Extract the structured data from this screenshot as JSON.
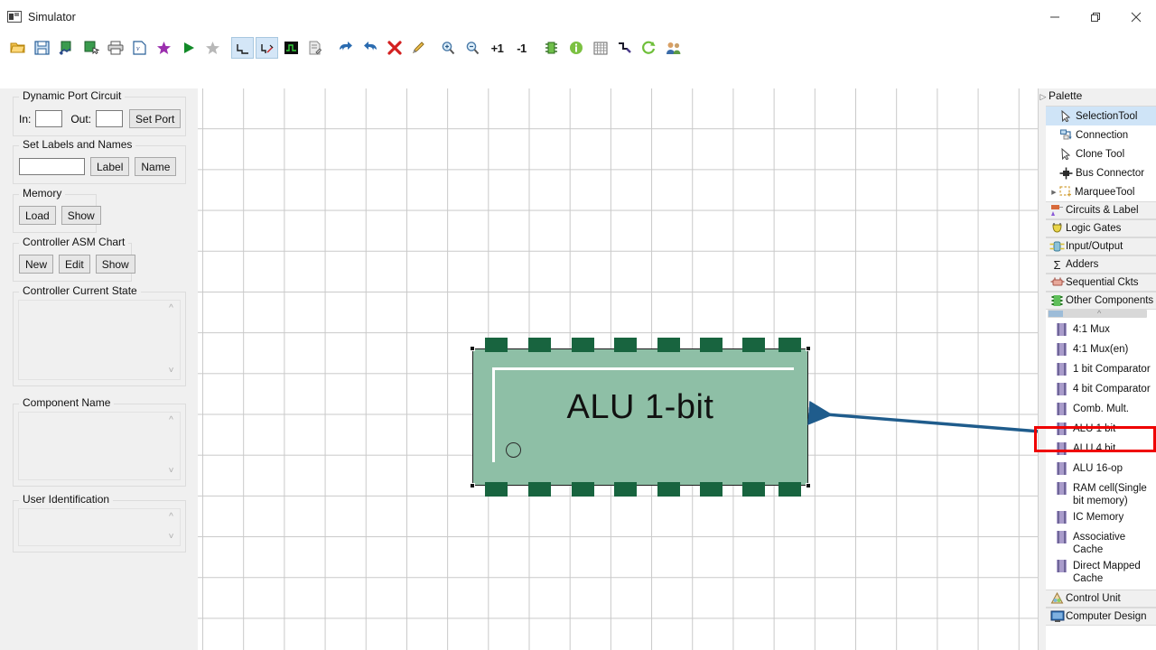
{
  "window": {
    "title": "Simulator",
    "icon": "app-icon",
    "controls": {
      "minimize": "minimize-icon",
      "restore": "restore-icon",
      "close": "close-icon"
    }
  },
  "toolbar": {
    "buttons": [
      {
        "name": "open-file",
        "icon": "folder-open-icon",
        "selected": false
      },
      {
        "name": "save-file",
        "icon": "floppy-disk-icon",
        "selected": false
      },
      {
        "name": "export-circuit",
        "icon": "export-icon",
        "selected": false
      },
      {
        "name": "import-circuit",
        "icon": "import-icon",
        "selected": false
      },
      {
        "name": "print",
        "icon": "printer-icon",
        "selected": false
      },
      {
        "name": "verilog-export",
        "icon": "verilog-file-icon",
        "selected": false
      },
      {
        "name": "favorite",
        "icon": "star-purple-icon",
        "selected": false
      },
      {
        "name": "run-simulation",
        "icon": "play-green-icon",
        "selected": false
      },
      {
        "name": "favorite-gray",
        "icon": "star-gray-icon",
        "selected": false
      },
      {
        "name": "timing-diagram",
        "icon": "waveform-icon",
        "selected": true
      },
      {
        "name": "timing-diagram-edit",
        "icon": "waveform-edit-icon",
        "selected": true
      },
      {
        "name": "circuit-trace",
        "icon": "trace-green-icon",
        "selected": false
      },
      {
        "name": "edit-notes",
        "icon": "notes-icon",
        "selected": false
      },
      {
        "name": "undo",
        "icon": "undo-arrow-icon",
        "selected": false
      },
      {
        "name": "redo",
        "icon": "redo-arrow-icon",
        "selected": false
      },
      {
        "name": "delete",
        "icon": "red-x-icon",
        "selected": false
      },
      {
        "name": "highlight",
        "icon": "pencil-icon",
        "selected": false
      },
      {
        "name": "zoom-in",
        "icon": "magnifier-plus-icon",
        "selected": false
      },
      {
        "name": "zoom-out",
        "icon": "magnifier-minus-icon",
        "selected": false
      },
      {
        "name": "increment",
        "icon": "plus-one-icon",
        "label": "+1",
        "selected": false
      },
      {
        "name": "decrement",
        "icon": "minus-one-icon",
        "label": "-1",
        "selected": false
      },
      {
        "name": "chip-view",
        "icon": "chip-green-icon",
        "selected": false
      },
      {
        "name": "info",
        "icon": "info-green-icon",
        "selected": false
      },
      {
        "name": "grid-toggle",
        "icon": "grid-icon",
        "selected": false
      },
      {
        "name": "wire-route",
        "icon": "wire-icon",
        "selected": false
      },
      {
        "name": "refresh",
        "icon": "refresh-green-icon",
        "selected": false
      },
      {
        "name": "users",
        "icon": "users-icon",
        "selected": false
      }
    ]
  },
  "left_panel": {
    "dynamic_port": {
      "title": "Dynamic Port Circuit",
      "in_label": "In:",
      "in_value": "",
      "out_label": "Out:",
      "out_value": "",
      "set_port_button": "Set Port"
    },
    "labels_names": {
      "title": "Set Labels and Names",
      "field_value": "",
      "label_button": "Label",
      "name_button": "Name"
    },
    "memory": {
      "title": "Memory",
      "load_button": "Load",
      "show_button": "Show"
    },
    "asm_chart": {
      "title": "Controller ASM Chart",
      "new_button": "New",
      "edit_button": "Edit",
      "show_button": "Show"
    },
    "controller_state": {
      "title": "Controller Current State",
      "content": ""
    },
    "component_name": {
      "title": "Component Name",
      "content": ""
    },
    "user_identification": {
      "title": "User Identification",
      "content": ""
    }
  },
  "canvas": {
    "component": {
      "label": "ALU 1-bit",
      "body_color": "#8ebfa6",
      "pin_color": "#18643f",
      "top_pin_count": 8,
      "bottom_pin_count": 8,
      "selected": true
    },
    "annotation": {
      "arrow_color": "#1f5c8c",
      "from": "palette-item-alu-1-bit",
      "to": "canvas-component-alu-1-bit"
    },
    "highlight_box_color": "#ef0000"
  },
  "palette": {
    "title": "Palette",
    "collapse_icon": "chevron-right-icon",
    "tools": [
      {
        "label": "SelectionTool",
        "icon": "cursor-arrow-icon",
        "selected": true
      },
      {
        "label": "Connection",
        "icon": "connection-icon",
        "selected": false
      },
      {
        "label": "Clone Tool",
        "icon": "cursor-arrow-icon",
        "selected": false
      },
      {
        "label": "Bus Connector",
        "icon": "bus-connector-icon",
        "selected": false
      },
      {
        "label": "MarqueeTool",
        "icon": "marquee-icon",
        "selected": false
      }
    ],
    "categories": [
      {
        "label": "Circuits & Label",
        "icon": "circuits-label-icon"
      },
      {
        "label": "Logic Gates",
        "icon": "logic-gates-icon"
      },
      {
        "label": "Input/Output",
        "icon": "input-output-icon"
      },
      {
        "label": "Adders",
        "icon": "sigma-icon"
      },
      {
        "label": "Sequential Ckts",
        "icon": "sequential-icon"
      },
      {
        "label": "Other Components",
        "icon": "chip-icon",
        "expanded": true
      }
    ],
    "components": [
      {
        "label": "4:1 Mux",
        "icon": "chip-icon",
        "highlighted": false
      },
      {
        "label": "4:1 Mux(en)",
        "icon": "chip-icon",
        "highlighted": false
      },
      {
        "label": "1 bit Comparator",
        "icon": "chip-icon",
        "highlighted": false
      },
      {
        "label": "4 bit Comparator",
        "icon": "chip-icon",
        "highlighted": false
      },
      {
        "label": "Comb. Mult.",
        "icon": "chip-icon",
        "highlighted": false
      },
      {
        "label": "ALU 1 bit",
        "icon": "chip-icon",
        "highlighted": true
      },
      {
        "label": "ALU 4 bit",
        "icon": "chip-icon",
        "highlighted": false
      },
      {
        "label": "ALU 16-op",
        "icon": "chip-icon",
        "highlighted": false
      },
      {
        "label": "RAM cell(Single bit memory)",
        "icon": "chip-icon",
        "highlighted": false
      },
      {
        "label": "IC Memory",
        "icon": "chip-icon",
        "highlighted": false
      },
      {
        "label": "Associative Cache",
        "icon": "chip-icon",
        "highlighted": false
      },
      {
        "label": "Direct Mapped Cache",
        "icon": "chip-icon",
        "highlighted": false
      }
    ],
    "footer_categories": [
      {
        "label": "Control Unit",
        "icon": "control-unit-icon"
      },
      {
        "label": "Computer Design",
        "icon": "monitor-icon"
      }
    ]
  }
}
